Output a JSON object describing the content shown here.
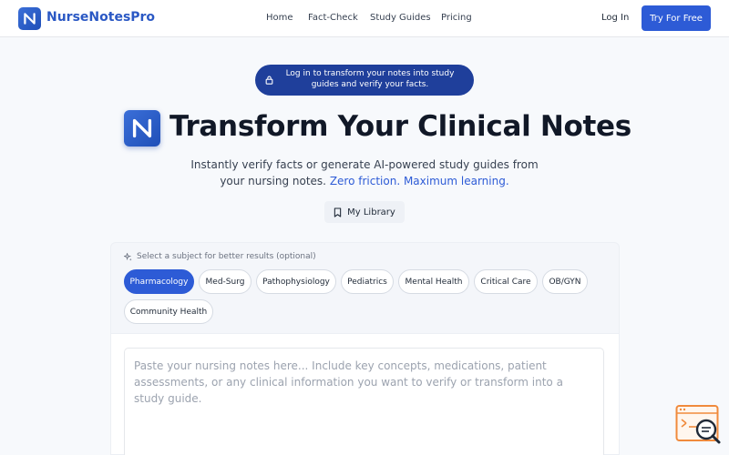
{
  "header": {
    "brand": "NurseNotesPro",
    "nav": [
      "Home",
      "Fact-Check",
      "Study Guides",
      "Pricing"
    ],
    "login_label": "Log In",
    "cta_label": "Try For Free"
  },
  "banner": {
    "text": "Log in to transform your notes into study guides and verify your facts."
  },
  "hero": {
    "title": "Transform Your Clinical Notes",
    "subtitle_prefix": "Instantly verify facts or generate AI-powered study guides from your nursing notes.",
    "subtitle_accent": "Zero friction. Maximum learning."
  },
  "library": {
    "label": "My Library"
  },
  "subjects": {
    "label": "Select a subject for better results (optional)",
    "items": [
      "Pharmacology",
      "Med-Surg",
      "Pathophysiology",
      "Pediatrics",
      "Mental Health",
      "Critical Care",
      "OB/GYN",
      "Community Health"
    ],
    "selected": "Pharmacology"
  },
  "notes": {
    "placeholder": "Paste your nursing notes here... Include key concepts, medications, patient assessments, or any clinical information you want to verify or transform into a study guide."
  },
  "colors": {
    "primary": "#2d5bd6",
    "banner": "#1f3f9b",
    "widget_accent": "#f08a3c"
  },
  "icons": [
    "logo-n-icon",
    "lock-icon",
    "bookmark-icon",
    "sparkle-icon",
    "search-doc-icon"
  ]
}
